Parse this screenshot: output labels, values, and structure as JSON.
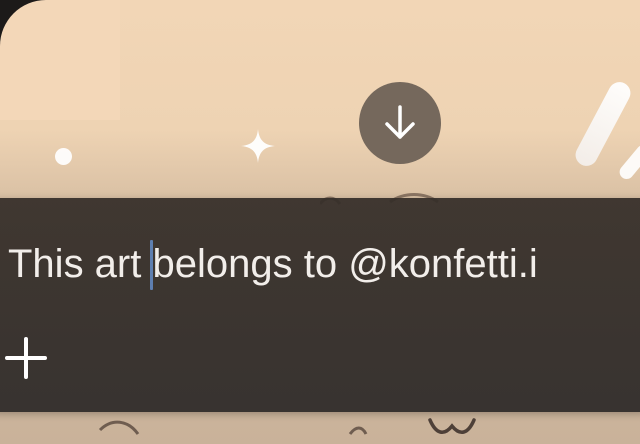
{
  "composer": {
    "text_before_cursor": "This art ",
    "text_after_cursor": "belongs to @konfetti.i",
    "add_button_icon": "plus-icon"
  },
  "scroll_to_bottom": {
    "icon": "arrow-down-icon"
  },
  "colors": {
    "background_top": "#f2d6b6",
    "composer_bg": "#352f2b",
    "text": "#f2eeea",
    "caret": "#5e7fb0",
    "scroll_button_bg": "#75685c"
  }
}
